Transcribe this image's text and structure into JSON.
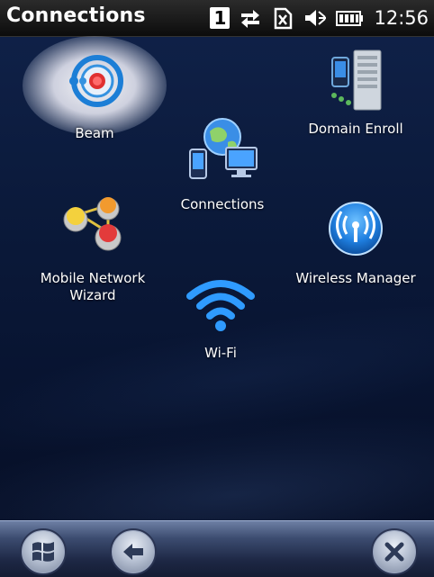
{
  "status_bar": {
    "title": "Connections",
    "badge": "1",
    "time": "12:56",
    "icons": [
      "data-transfer-icon",
      "sim-card-icon",
      "volume-muted-icon",
      "battery-icon"
    ]
  },
  "apps": [
    {
      "label": "Beam",
      "icon": "beam-icon"
    },
    {
      "label": "Domain Enroll",
      "icon": "domain-enroll-icon"
    },
    {
      "label": "Connections",
      "icon": "connections-icon"
    },
    {
      "label_line1": "Mobile Network",
      "label_line2": "Wizard",
      "icon": "network-wizard-icon"
    },
    {
      "label": "Wireless Manager",
      "icon": "wireless-manager-icon"
    },
    {
      "label": "Wi-Fi",
      "icon": "wifi-icon"
    }
  ],
  "bottom_bar": {
    "buttons": [
      "start-button",
      "back-button",
      "close-button"
    ]
  }
}
